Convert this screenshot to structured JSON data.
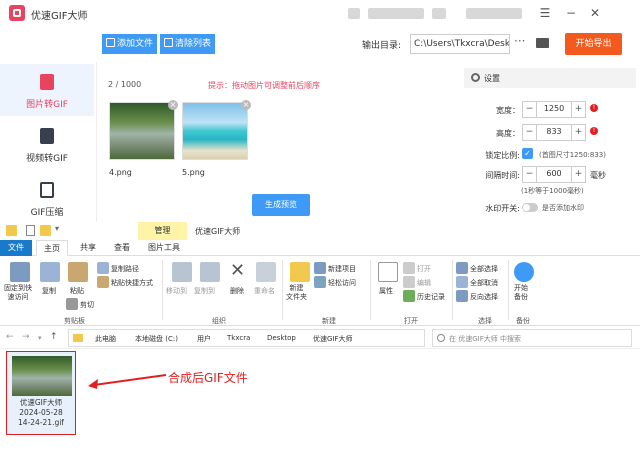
{
  "app": {
    "title": "优速GIF大师",
    "window_controls": [
      "☰",
      "−",
      "✕"
    ]
  },
  "toolbar": {
    "add_file": "添加文件",
    "clear_list": "清除列表",
    "output_label": "输出目录:",
    "output_path": "C:\\Users\\Tkxcra\\Deskto",
    "more": "···",
    "start_export": "开始导出"
  },
  "sidebar": {
    "items": [
      {
        "label": "图片转GIF",
        "icon": "image-file-icon",
        "active": true
      },
      {
        "label": "视频转GIF",
        "icon": "video-file-icon",
        "active": false
      },
      {
        "label": "GIF压缩",
        "icon": "compress-icon",
        "active": false
      }
    ]
  },
  "workspace": {
    "counter": "2 / 1000",
    "hint": "提示：拖动图片可调整前后顺序",
    "images": [
      {
        "name": "4.png"
      },
      {
        "name": "5.png"
      }
    ],
    "generate_preview": "生成预览"
  },
  "settings": {
    "title": "设置",
    "width_label": "宽度：",
    "width_value": "1250",
    "height_label": "高度：",
    "height_value": "833",
    "lock_label": "锁定比例:",
    "lock_note": "(首图尺寸1250:833)",
    "interval_label": "间隔时间:",
    "interval_value": "600",
    "interval_unit": "毫秒",
    "interval_note": "(1秒等于1000毫秒)",
    "watermark_label": "水印开关:",
    "watermark_note": "是否添加水印"
  },
  "explorer": {
    "context_tab": "管理",
    "title": "优速GIF大师",
    "tabs": [
      "文件",
      "主页",
      "共享",
      "查看",
      "图片工具"
    ],
    "ribbon": {
      "pin_quick": "固定到快\n速访问",
      "copy": "复制",
      "paste": "粘贴",
      "copy_path": "复制路径",
      "paste_shortcut": "粘贴快捷方式",
      "cut": "剪切",
      "clipboard": "剪贴板",
      "move_to": "移动到",
      "copy_to": "复制到",
      "delete": "删除",
      "rename": "重命名",
      "organize": "组织",
      "new_folder": "新建\n文件夹",
      "new_item": "新建项目",
      "easy_access": "轻松访问",
      "new": "新建",
      "properties": "属性",
      "open": "打开",
      "edit": "编辑",
      "history": "历史记录",
      "open_group": "打开",
      "select_all": "全部选择",
      "select_none": "全部取消",
      "invert": "反向选择",
      "select": "选择",
      "start_backup": "开始\n备份",
      "backup": "备份"
    },
    "breadcrumb": [
      "此电脑",
      "本地磁盘 (C:)",
      "用户",
      "Tkxcra",
      "Desktop",
      "优速GIF大师"
    ],
    "search_placeholder": "在 优速GIF大师 中搜索",
    "file": {
      "name_line1": "优速GIF大师",
      "name_line2": "2024-05-28",
      "name_line3": "14-24-21.gif"
    },
    "annotation": "合成后GIF文件"
  },
  "colors": {
    "accent": "#3e9af4",
    "export": "#f45a1e",
    "brand": "#e8435f",
    "warning": "#e02020",
    "ribbon_file": "#1979ca",
    "context_tab": "#fff3a8"
  }
}
